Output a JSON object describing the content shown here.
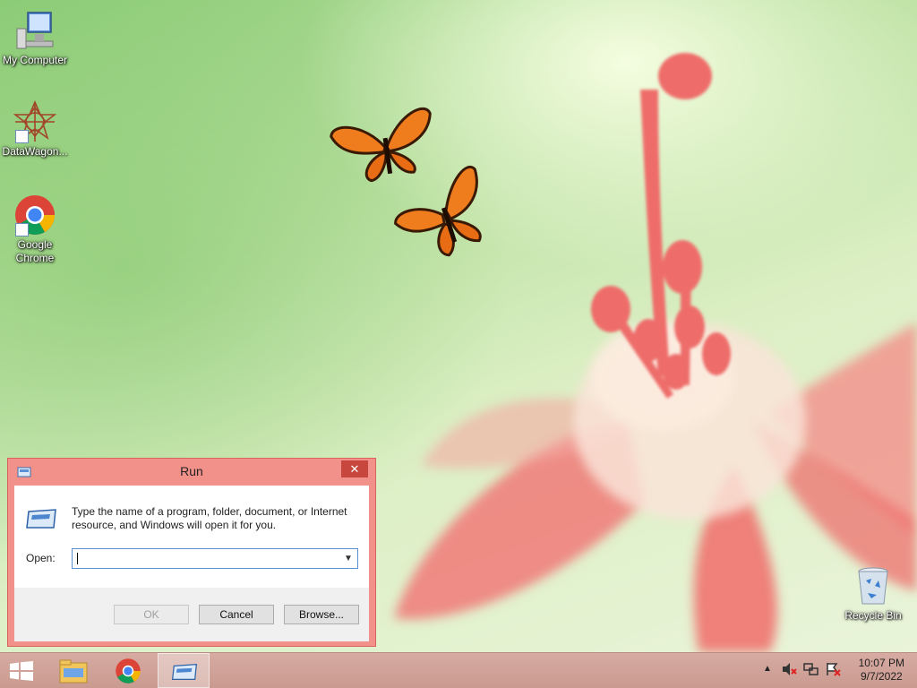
{
  "desktop": {
    "icons": [
      {
        "label": "My Computer",
        "icon": "computer-icon"
      },
      {
        "label": "DataWagon...",
        "icon": "datawagon-icon"
      },
      {
        "label": "Google Chrome",
        "icon": "chrome-icon"
      },
      {
        "label": "Recycle Bin",
        "icon": "recycle-bin-icon"
      }
    ]
  },
  "run_dialog": {
    "title": "Run",
    "close": "✕",
    "description": "Type the name of a program, folder, document, or Internet resource, and Windows will open it for you.",
    "open_label": "Open:",
    "open_value": "",
    "ok_label": "OK",
    "cancel_label": "Cancel",
    "browse_label": "Browse..."
  },
  "taskbar": {
    "apps": [
      "file-explorer-icon",
      "chrome-icon",
      "run-icon"
    ],
    "tray_icons": [
      "show-hidden-icons",
      "volume-muted-icon",
      "network-icon",
      "action-center-icon"
    ],
    "clock": {
      "time": "10:07 PM",
      "date": "9/7/2022"
    }
  },
  "colors": {
    "accent": "#f29189",
    "close": "#c7473e",
    "taskbar": "#d2a49b"
  }
}
